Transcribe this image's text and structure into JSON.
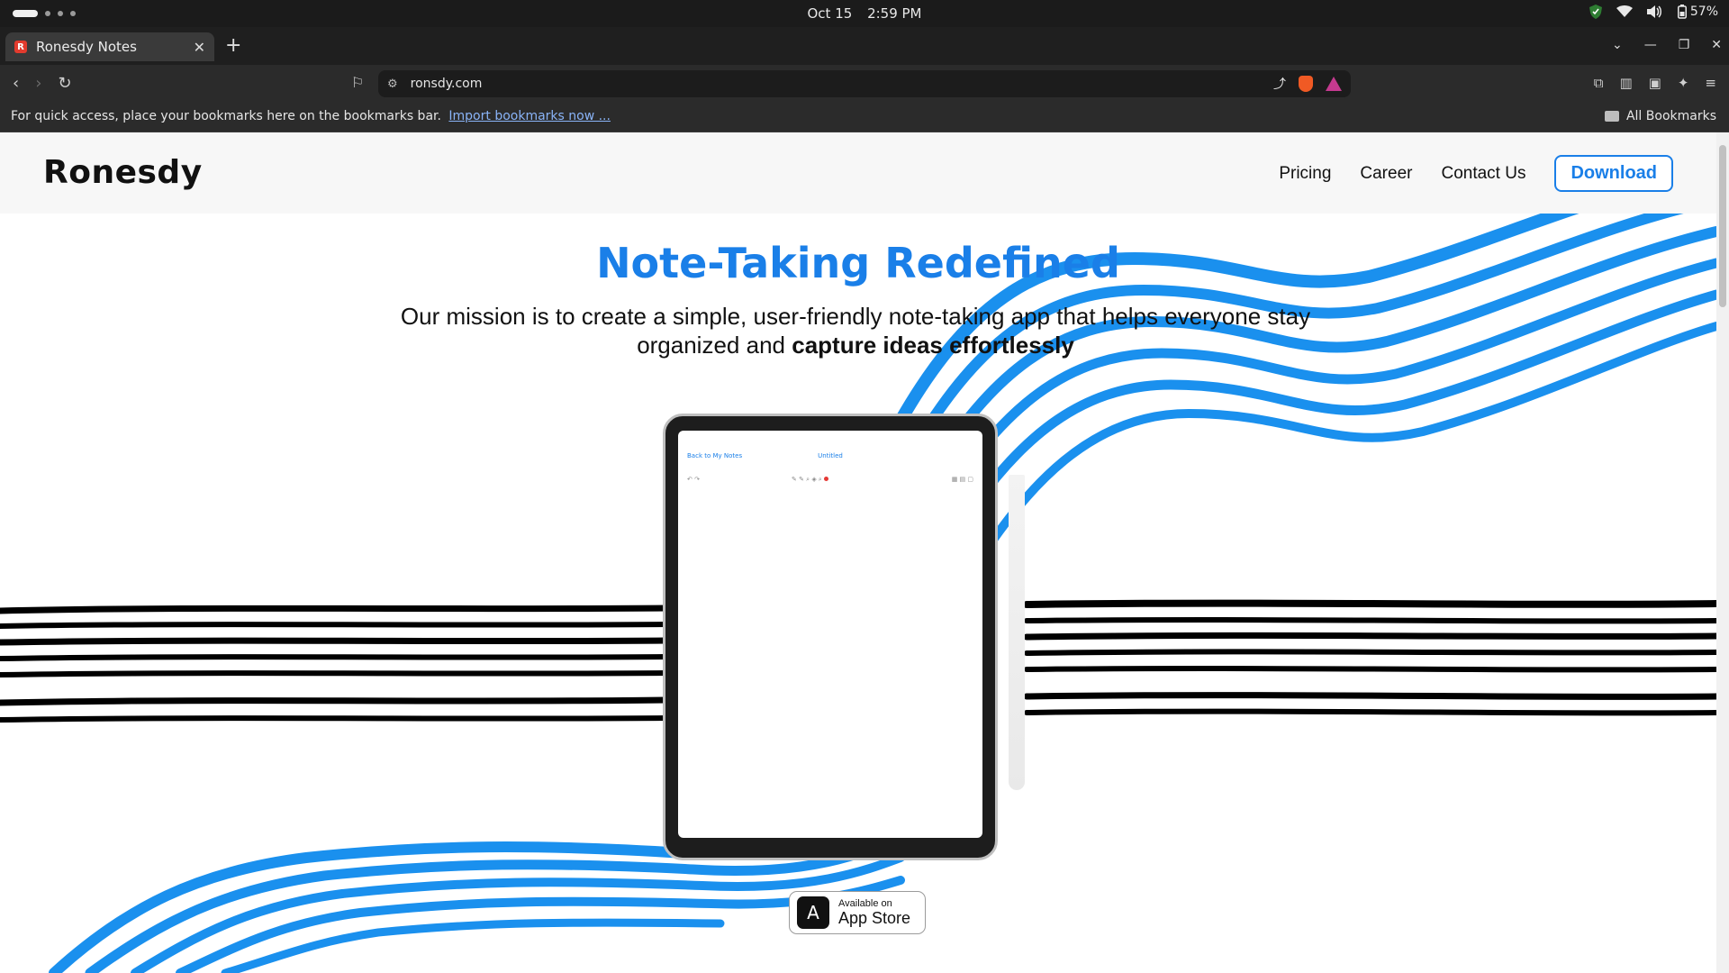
{
  "os": {
    "date": "Oct 15",
    "time": "2:59 PM",
    "battery": "57%"
  },
  "browser": {
    "tab_title": "Ronesdy Notes",
    "url": "ronsdy.com",
    "bookmarks_hint": "For quick access, place your bookmarks here on the bookmarks bar.",
    "import_link": "Import bookmarks now ...",
    "all_bookmarks": "All Bookmarks"
  },
  "site": {
    "logo": "Ronesdy",
    "nav": {
      "pricing": "Pricing",
      "career": "Career",
      "contact": "Contact Us",
      "download": "Download"
    },
    "hero": {
      "title": "Note-Taking Redefined",
      "subtitle_plain": "Our mission is to create a simple, user-friendly note-taking app that helps everyone stay organized and",
      "subtitle_bold": "capture ideas effortlessly"
    },
    "tablet": {
      "back_link": "Back to My Notes",
      "note_title": "Untitled"
    },
    "appstore": {
      "small": "Available on",
      "big": "App Store"
    }
  },
  "colors": {
    "brand_blue": "#1a7fe8",
    "stroke_black": "#000000"
  }
}
